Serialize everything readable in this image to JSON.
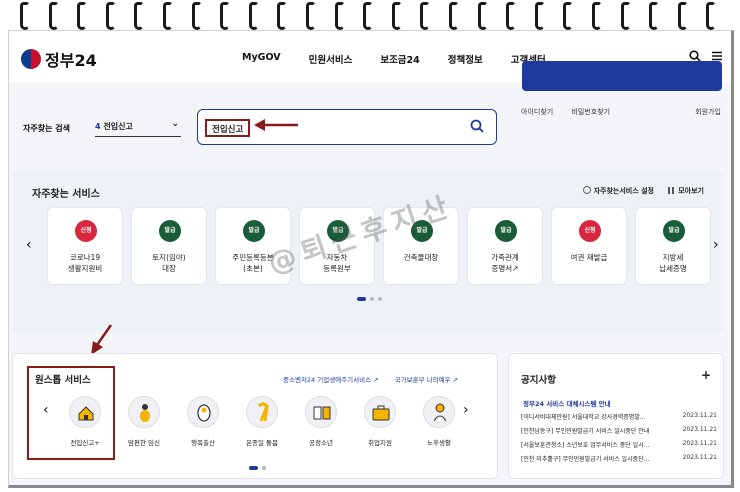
{
  "header": {
    "logo_text": "정부24",
    "nav": [
      "MyGOV",
      "민원서비스",
      "보조금24",
      "정책정보",
      "고객센터"
    ]
  },
  "login": {
    "find_id": "아이디찾기",
    "find_pw": "비밀번호찾기",
    "signup": "회원가입"
  },
  "search": {
    "label": "자주찾는 검색",
    "select_num": "4",
    "select_text": "전입신고",
    "value": "전입신고"
  },
  "frequent": {
    "title": "자주찾는 서비스",
    "settings_label": "자주찾는서비스 설정",
    "view_all_label": "모아보기",
    "tiles": [
      {
        "badge": "신청",
        "color": "red",
        "label": "코로나19\n생활지원비"
      },
      {
        "badge": "발급",
        "color": "green",
        "label": "토지(임야)\n대장"
      },
      {
        "badge": "발급",
        "color": "green",
        "label": "주민등록등본\n(초본)"
      },
      {
        "badge": "발급",
        "color": "green",
        "label": "자동차\n등록원부"
      },
      {
        "badge": "발급",
        "color": "green",
        "label": "건축물대장"
      },
      {
        "badge": "발급",
        "color": "green",
        "label": "가족관계\n증명서↗"
      },
      {
        "badge": "신청",
        "color": "red",
        "label": "여권 재발급"
      },
      {
        "badge": "발급",
        "color": "green",
        "label": "지방세\n납세증명"
      }
    ]
  },
  "onestop": {
    "title": "원스톱 서비스",
    "link1": "중소벤처24 기업생애주기서비스 ↗",
    "link2": "국가보훈부 나의예우 ↗",
    "services": [
      {
        "label": "전입신고+",
        "icon": "home-icon"
      },
      {
        "label": "맘편한 임신",
        "icon": "pregnancy-icon"
      },
      {
        "label": "행복출산",
        "icon": "baby-icon"
      },
      {
        "label": "온종일 돌봄",
        "icon": "ribbon-icon"
      },
      {
        "label": "공정소년",
        "icon": "book-icon"
      },
      {
        "label": "취업지원",
        "icon": "briefcase-icon"
      },
      {
        "label": "노후생활",
        "icon": "elder-icon"
      }
    ]
  },
  "notice": {
    "title": "공지사항",
    "plus": "+",
    "headline": "정부24 서비스 대체시스템 안내",
    "rows": [
      {
        "text": "[이디서비대체안원] 서울대학교 강사경력증명발...",
        "date": "2023.11.21"
      },
      {
        "text": "[인천남동구] 무인민원발급기 서비스 일시중단 안내",
        "date": "2023.11.21"
      },
      {
        "text": "[서울보훈관청소] 소년보호 업무서비스 중단 일시...",
        "date": "2023.11.21"
      },
      {
        "text": "[인천 미추홀구] 무인민원발급기 서비스 일시중단...",
        "date": "2023.11.21"
      }
    ]
  },
  "watermark": "@퇴근후지산"
}
